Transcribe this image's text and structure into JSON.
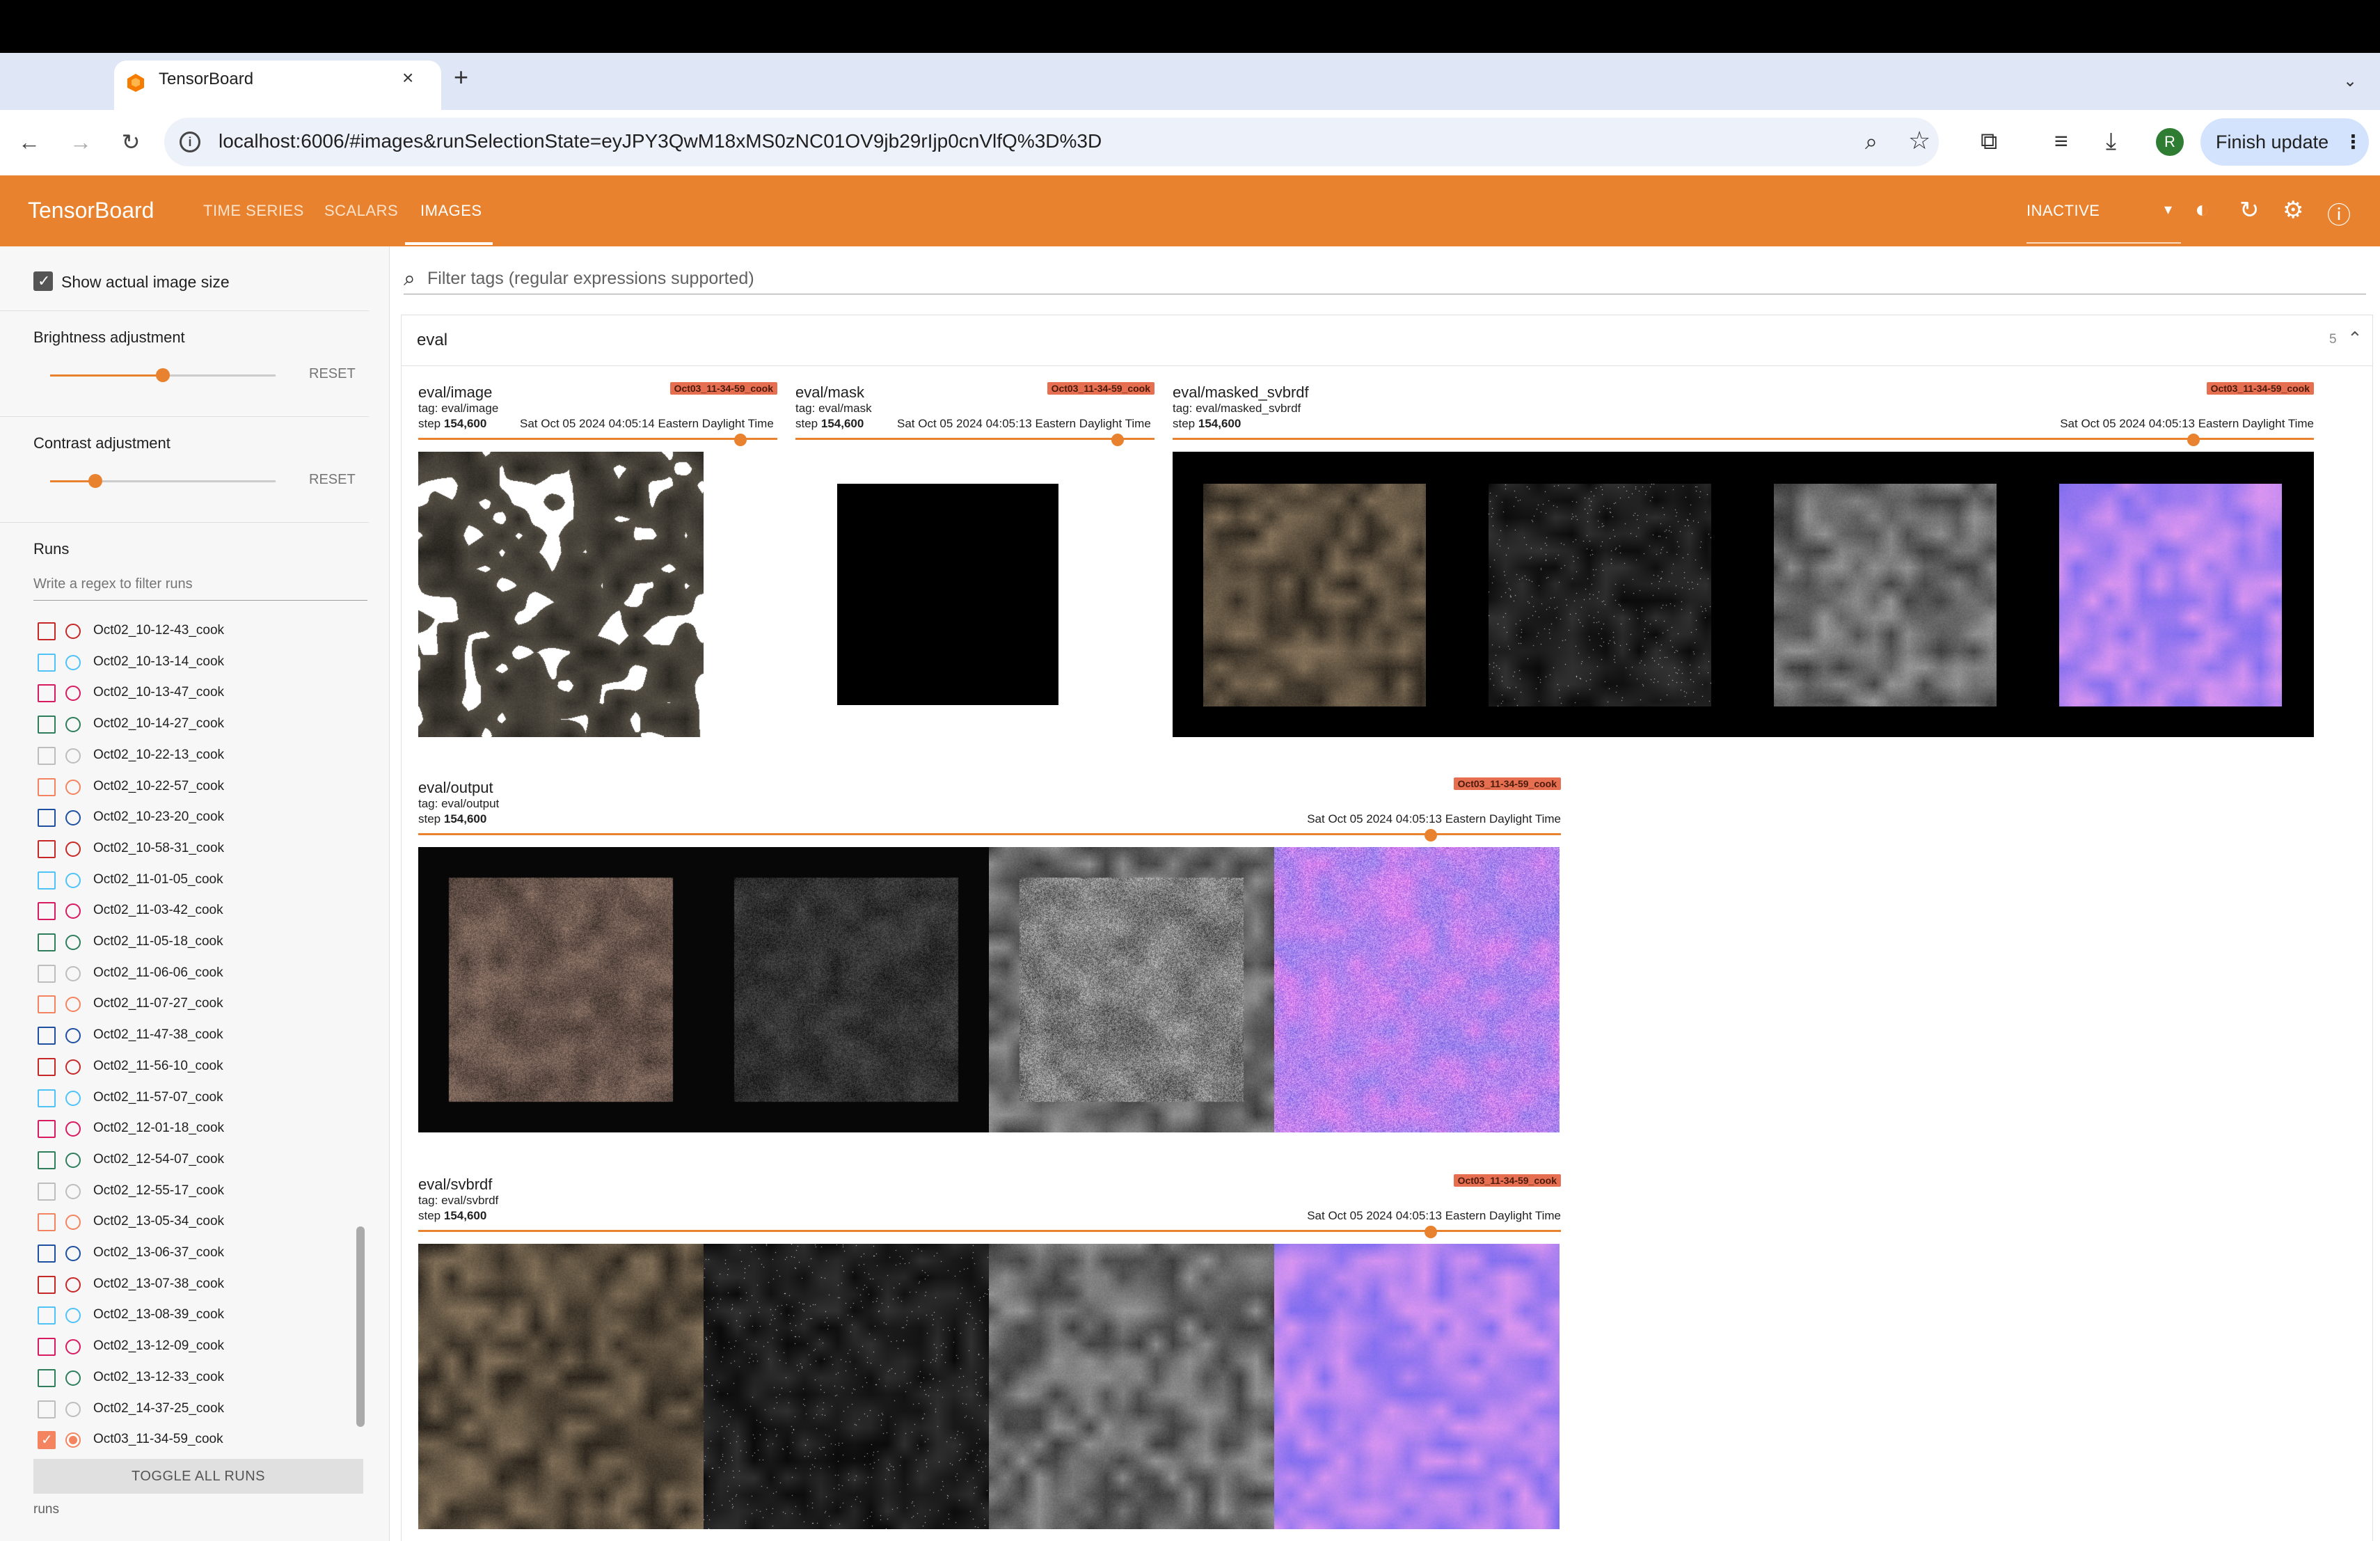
{
  "browser": {
    "tab_title": "TensorBoard",
    "tab_close": "×",
    "new_tab": "+",
    "url": "localhost:6006/#images&runSelectionState=eyJPY3QwM18xMS0zNC01OV9jb29rIjp0cnVlfQ%3D%3D",
    "finish_update": "Finish update",
    "profile_initial": "R",
    "icons": [
      "back-icon",
      "forward-icon",
      "reload-icon",
      "site-info-icon",
      "zoom-icon",
      "bookmark-star-icon",
      "extensions-icon",
      "media-icon",
      "download-icon",
      "menu-icon"
    ]
  },
  "header": {
    "logo": "TensorBoard",
    "tabs": [
      "TIME SERIES",
      "SCALARS",
      "IMAGES"
    ],
    "active_tab": "IMAGES",
    "run_status": "INACTIVE",
    "accent": "#e8822e"
  },
  "sidebar": {
    "show_actual_label": "Show actual image size",
    "show_actual_checked": true,
    "brightness_label": "Brightness adjustment",
    "brightness_value": 0.5,
    "contrast_label": "Contrast adjustment",
    "contrast_value": 0.2,
    "reset_label": "RESET",
    "runs_title": "Runs",
    "runs_filter_placeholder": "Write a regex to filter runs",
    "runs": [
      {
        "name": "Oct02_10-12-43_cook",
        "color": "#c62828",
        "checked": false
      },
      {
        "name": "Oct02_10-13-14_cook",
        "color": "#4fc3f7",
        "checked": false
      },
      {
        "name": "Oct02_10-13-47_cook",
        "color": "#d81b60",
        "checked": false
      },
      {
        "name": "Oct02_10-14-27_cook",
        "color": "#2e7d5b",
        "checked": false
      },
      {
        "name": "Oct02_10-22-13_cook",
        "color": "#bdbdbd",
        "checked": false
      },
      {
        "name": "Oct02_10-22-57_cook",
        "color": "#f4845f",
        "checked": false
      },
      {
        "name": "Oct02_10-23-20_cook",
        "color": "#1e4fa0",
        "checked": false
      },
      {
        "name": "Oct02_10-58-31_cook",
        "color": "#c62828",
        "checked": false
      },
      {
        "name": "Oct02_11-01-05_cook",
        "color": "#4fc3f7",
        "checked": false
      },
      {
        "name": "Oct02_11-03-42_cook",
        "color": "#d81b60",
        "checked": false
      },
      {
        "name": "Oct02_11-05-18_cook",
        "color": "#2e7d5b",
        "checked": false
      },
      {
        "name": "Oct02_11-06-06_cook",
        "color": "#bdbdbd",
        "checked": false
      },
      {
        "name": "Oct02_11-07-27_cook",
        "color": "#f4845f",
        "checked": false
      },
      {
        "name": "Oct02_11-47-38_cook",
        "color": "#1e4fa0",
        "checked": false
      },
      {
        "name": "Oct02_11-56-10_cook",
        "color": "#c62828",
        "checked": false
      },
      {
        "name": "Oct02_11-57-07_cook",
        "color": "#4fc3f7",
        "checked": false
      },
      {
        "name": "Oct02_12-01-18_cook",
        "color": "#d81b60",
        "checked": false
      },
      {
        "name": "Oct02_12-54-07_cook",
        "color": "#2e7d5b",
        "checked": false
      },
      {
        "name": "Oct02_12-55-17_cook",
        "color": "#bdbdbd",
        "checked": false
      },
      {
        "name": "Oct02_13-05-34_cook",
        "color": "#f4845f",
        "checked": false
      },
      {
        "name": "Oct02_13-06-37_cook",
        "color": "#1e4fa0",
        "checked": false
      },
      {
        "name": "Oct02_13-07-38_cook",
        "color": "#c62828",
        "checked": false
      },
      {
        "name": "Oct02_13-08-39_cook",
        "color": "#4fc3f7",
        "checked": false
      },
      {
        "name": "Oct02_13-12-09_cook",
        "color": "#d81b60",
        "checked": false
      },
      {
        "name": "Oct02_13-12-33_cook",
        "color": "#2e7d5b",
        "checked": false
      },
      {
        "name": "Oct02_14-37-25_cook",
        "color": "#bdbdbd",
        "checked": false
      },
      {
        "name": "Oct03_11-34-59_cook",
        "color": "#f4845f",
        "checked": true
      }
    ],
    "toggle_all": "TOGGLE ALL RUNS",
    "footer": "runs"
  },
  "main": {
    "filter_placeholder": "Filter tags (regular expressions supported)",
    "group": {
      "name": "eval",
      "count": "5",
      "cards": [
        {
          "title": "eval/image",
          "tag": "tag: eval/image",
          "step_prefix": "step ",
          "step": "154,600",
          "time": "Sat Oct 05 2024 04:05:14 Eastern Daylight Time",
          "run": "Oct03_11-34-59_cook",
          "kind": "image"
        },
        {
          "title": "eval/mask",
          "tag": "tag: eval/mask",
          "step_prefix": "step ",
          "step": "154,600",
          "time": "Sat Oct 05 2024 04:05:13 Eastern Daylight Time",
          "run": "Oct03_11-34-59_cook",
          "kind": "mask"
        },
        {
          "title": "eval/masked_svbrdf",
          "tag": "tag: eval/masked_svbrdf",
          "step_prefix": "step ",
          "step": "154,600",
          "time": "Sat Oct 05 2024 04:05:13 Eastern Daylight Time",
          "run": "Oct03_11-34-59_cook",
          "kind": "masked"
        },
        {
          "title": "eval/output",
          "tag": "tag: eval/output",
          "step_prefix": "step ",
          "step": "154,600",
          "time": "Sat Oct 05 2024 04:05:13 Eastern Daylight Time",
          "run": "Oct03_11-34-59_cook",
          "kind": "output"
        },
        {
          "title": "eval/svbrdf",
          "tag": "tag: eval/svbrdf",
          "step_prefix": "step ",
          "step": "154,600",
          "time": "Sat Oct 05 2024 04:05:13 Eastern Daylight Time",
          "run": "Oct03_11-34-59_cook",
          "kind": "svbrdf"
        }
      ]
    }
  }
}
